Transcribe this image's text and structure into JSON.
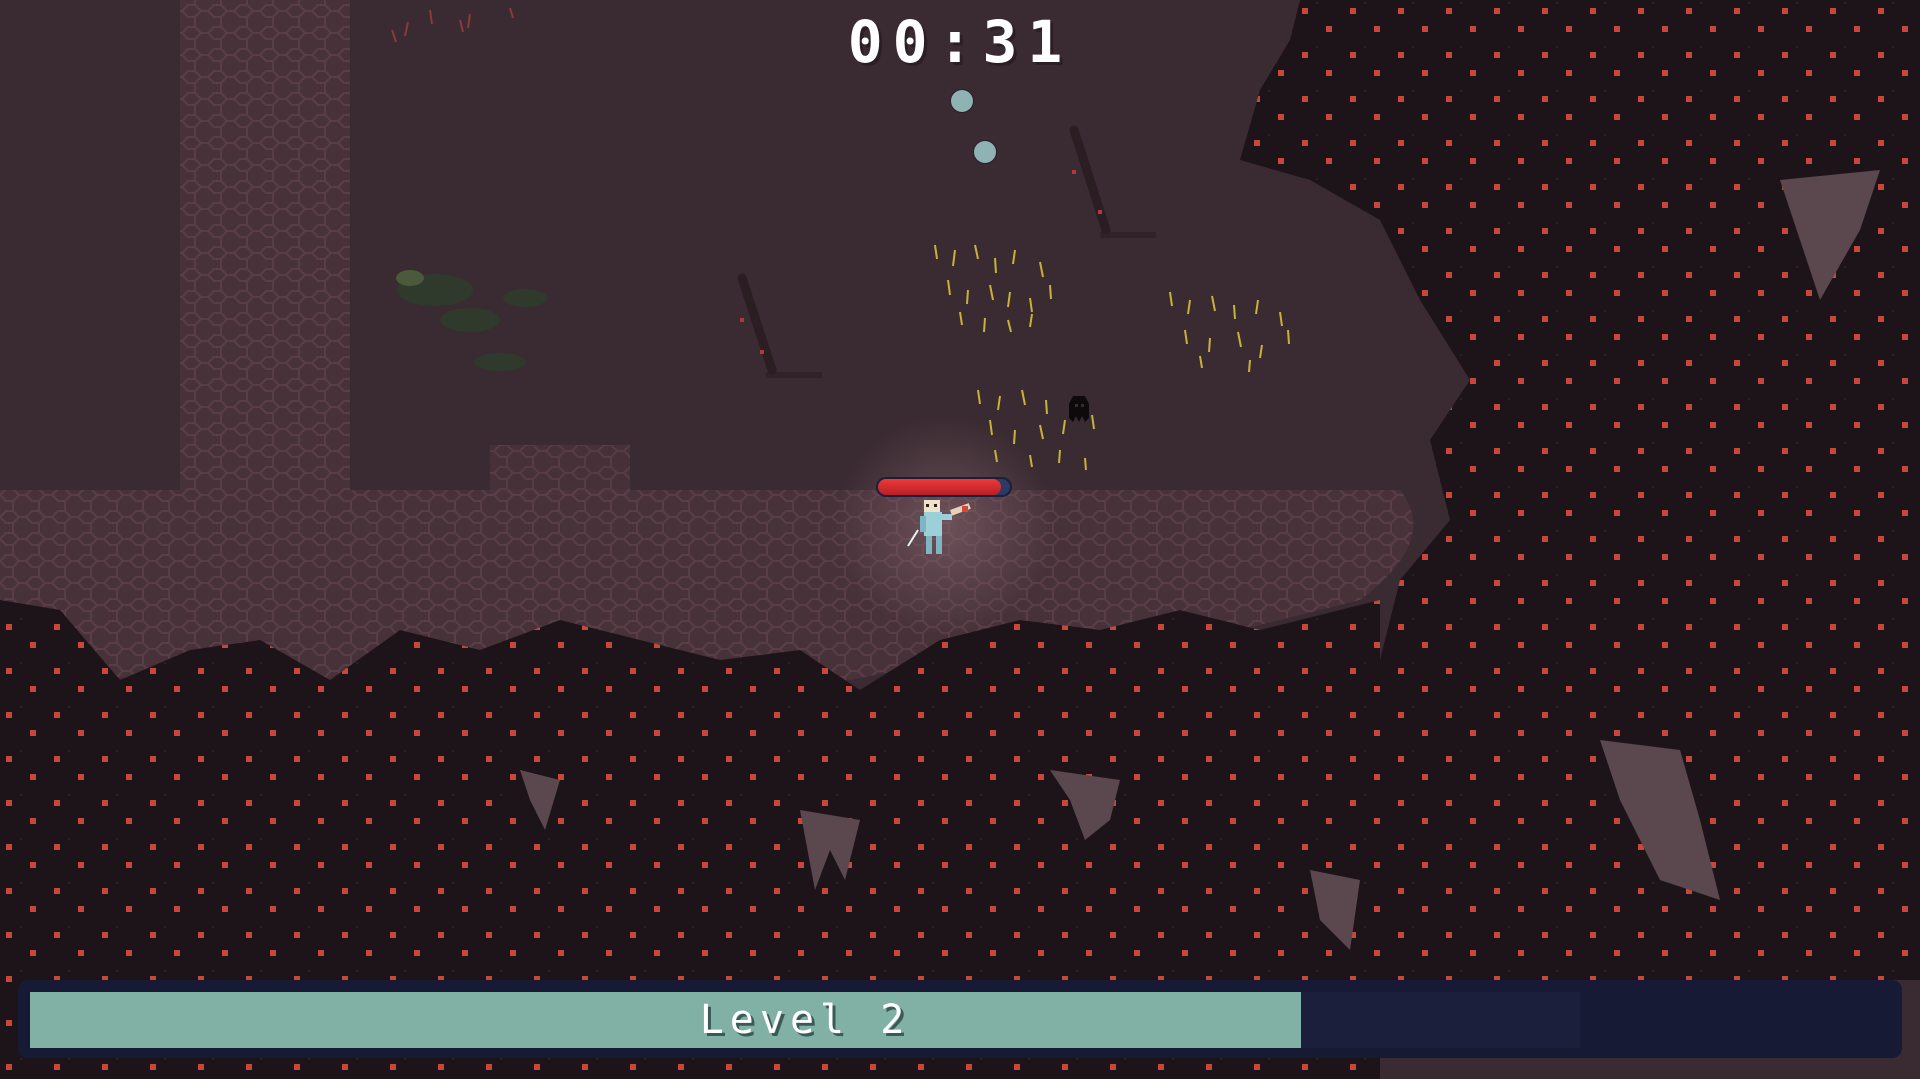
{
  "hud": {
    "timer": "00:31",
    "level_label": "Level 2",
    "xp_progress": 0.82
  },
  "player": {
    "health_fraction": 0.93
  },
  "xp_orbs": 2,
  "colors": {
    "ground": "#3a2a31",
    "forest": "#1c1418",
    "berry": "#c8473a",
    "xp_fill": "#81b0a5",
    "xp_track": "#161a34",
    "hp_fill": "#e02b2b",
    "hp_track": "#2c3a66",
    "orb": "#8fb3b4",
    "grass": "#c9b23a"
  },
  "icons": {
    "player": "hero-sprite",
    "enemy": "shadow-creature-sprite",
    "pickup": "xp-orb"
  }
}
